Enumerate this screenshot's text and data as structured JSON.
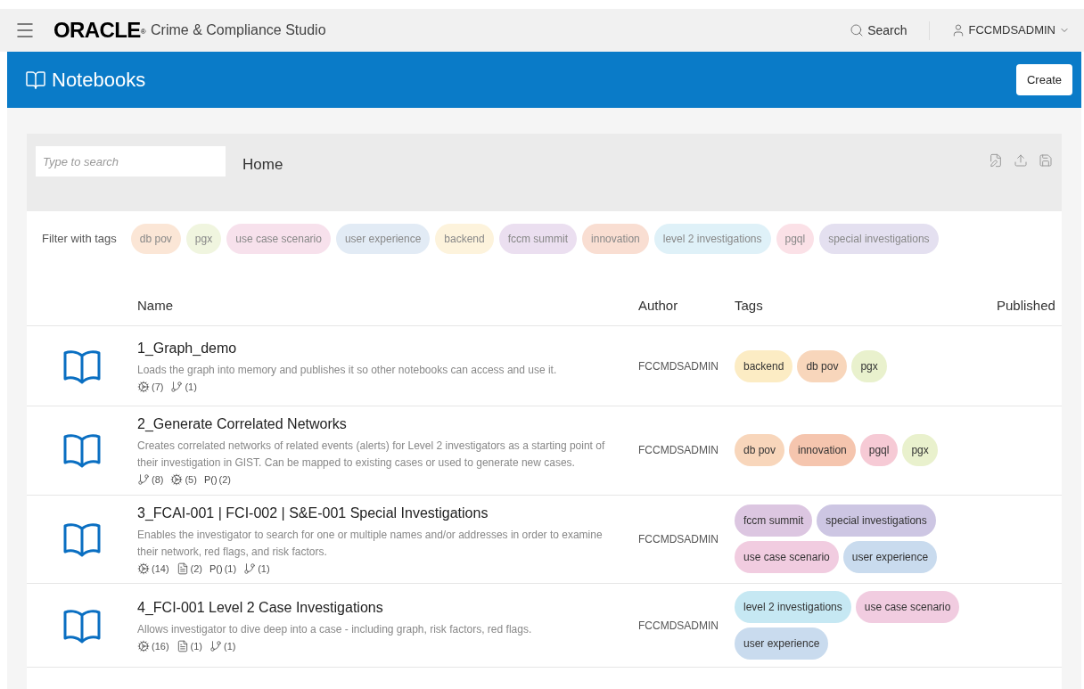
{
  "topbar": {
    "brand": "ORACLE",
    "brand_mark": "®",
    "product": "Crime & Compliance Studio",
    "search": "Search",
    "user": "FCCMDSADMIN"
  },
  "header": {
    "title": "Notebooks",
    "create": "Create"
  },
  "toolbar": {
    "search_placeholder": "Type to search",
    "breadcrumb": "Home"
  },
  "filter": {
    "label": "Filter with tags",
    "tags": [
      {
        "label": "db pov",
        "color": "#fbe6d6"
      },
      {
        "label": "pgx",
        "color": "#f0f5df"
      },
      {
        "label": "use case scenario",
        "color": "#f7e1ec"
      },
      {
        "label": "user experience",
        "color": "#e2ebf5"
      },
      {
        "label": "backend",
        "color": "#fdf3dc"
      },
      {
        "label": "fccm summit",
        "color": "#ebdff0"
      },
      {
        "label": "innovation",
        "color": "#f9ded2"
      },
      {
        "label": "level 2 investigations",
        "color": "#dff1f8"
      },
      {
        "label": "pgql",
        "color": "#fbe1e7"
      },
      {
        "label": "special investigations",
        "color": "#e4e0f0"
      }
    ]
  },
  "table": {
    "columns": [
      "Name",
      "Author",
      "Tags",
      "Published"
    ],
    "rows": [
      {
        "name": "1_Graph_demo",
        "description": "Loads the graph into memory and publishes it so other notebooks can access and use it.",
        "meta": [
          {
            "kind": "paragraphs",
            "count": "(7)"
          },
          {
            "kind": "branch",
            "count": "(1)"
          }
        ],
        "author": "FCCMDSADMIN",
        "tags": [
          {
            "label": "backend",
            "color": "#fcecc4"
          },
          {
            "label": "db pov",
            "color": "#f8d6bb"
          },
          {
            "label": "pgx",
            "color": "#e9f1cd"
          }
        ]
      },
      {
        "name": "2_Generate Correlated Networks",
        "description": "Creates correlated networks of related events (alerts) for Level 2 investigators as a starting point of their investigation in GIST. Can be mapped to existing cases or used to generate new cases.",
        "meta": [
          {
            "kind": "branch",
            "count": "(8)"
          },
          {
            "kind": "paragraphs",
            "count": "(5)"
          },
          {
            "kind": "params",
            "glyph": "P()",
            "count": "(2)"
          }
        ],
        "author": "FCCMDSADMIN",
        "tags": [
          {
            "label": "db pov",
            "color": "#f8d6bb"
          },
          {
            "label": "innovation",
            "color": "#f5c5ae"
          },
          {
            "label": "pgql",
            "color": "#f6cad5"
          },
          {
            "label": "pgx",
            "color": "#e9f1cd"
          }
        ]
      },
      {
        "name": "3_FCAI-001 | FCI-002 | S&E-001 Special Investigations",
        "description": "Enables the investigator to search for one or multiple names and/or addresses in order to examine their network, red flags, and risk factors.",
        "meta": [
          {
            "kind": "paragraphs",
            "count": "(14)"
          },
          {
            "kind": "document",
            "count": "(2)"
          },
          {
            "kind": "params",
            "glyph": "P()",
            "count": "(1)"
          },
          {
            "kind": "branch",
            "count": "(1)"
          }
        ],
        "author": "FCCMDSADMIN",
        "tags": [
          {
            "label": "fccm summit",
            "color": "#dcc6e1"
          },
          {
            "label": "special investigations",
            "color": "#cdc6e3"
          },
          {
            "label": "use case scenario",
            "color": "#f1cce0"
          },
          {
            "label": "user experience",
            "color": "#c9dbee"
          }
        ]
      },
      {
        "name": "4_FCI-001 Level 2 Case Investigations",
        "description": "Allows investigator to dive deep into a case - including graph, risk factors, red flags.",
        "meta": [
          {
            "kind": "paragraphs",
            "count": "(16)"
          },
          {
            "kind": "document",
            "count": "(1)"
          },
          {
            "kind": "branch",
            "count": "(1)"
          }
        ],
        "author": "FCCMDSADMIN",
        "tags": [
          {
            "label": "level 2 investigations",
            "color": "#c6e8f3"
          },
          {
            "label": "use case scenario",
            "color": "#f1cce0"
          },
          {
            "label": "user experience",
            "color": "#c9dbee"
          }
        ]
      }
    ]
  }
}
